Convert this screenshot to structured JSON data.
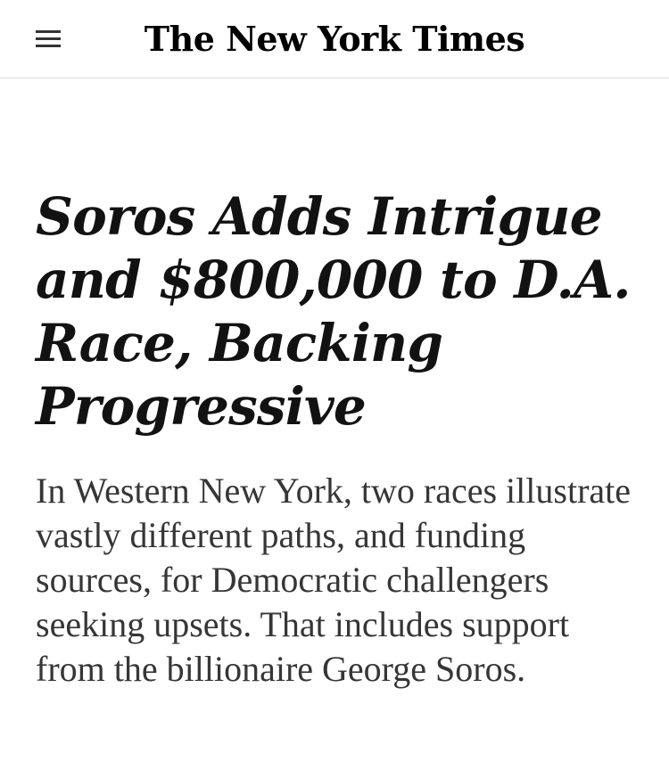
{
  "masthead": {
    "logo_text": "The New York Times",
    "menu_icon": "hamburger-menu-icon"
  },
  "article": {
    "headline": "Soros Adds Intrigue and $800,000 to D.A. Race, Backing Progressive",
    "summary": "In Western New York, two races illustrate vastly different paths, and funding sources, for Democratic challengers seeking upsets. That includes support from the billionaire George Soros."
  }
}
